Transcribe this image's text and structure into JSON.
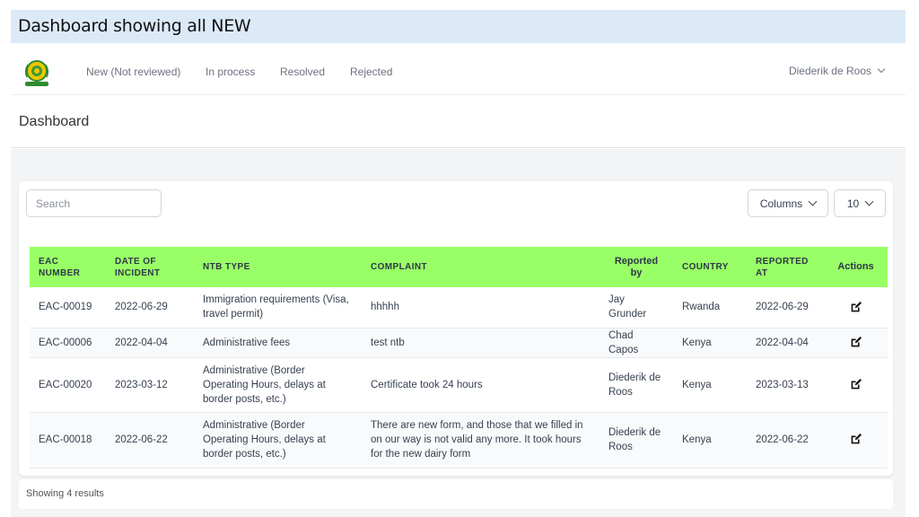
{
  "banner": {
    "title": "Dashboard showing all NEW"
  },
  "nav": {
    "items": [
      "New (Not reviewed)",
      "In process",
      "Resolved",
      "Rejected"
    ],
    "user": "Diederik de Roos"
  },
  "header": {
    "title": "Dashboard"
  },
  "toolbar": {
    "search_placeholder": "Search",
    "columns_label": "Columns",
    "page_size": "10"
  },
  "table": {
    "headers": {
      "eac1": "EAC",
      "eac2": "NUMBER",
      "date1": "DATE OF",
      "date2": "INCIDENT",
      "ntb": "NTB TYPE",
      "complaint": "COMPLAINT",
      "rep1": "Reported",
      "rep2": "by",
      "country": "COUNTRY",
      "at1": "REPORTED",
      "at2": "AT",
      "actions": "Actions"
    },
    "rows": [
      {
        "eac": "EAC-00019",
        "date": "2022-06-29",
        "ntb": "Immigration requirements (Visa, travel permit)",
        "complaint": "hhhhh",
        "by": "Jay Grunder",
        "country": "Rwanda",
        "at": "2022-06-29"
      },
      {
        "eac": "EAC-00006",
        "date": "2022-04-04",
        "ntb": "Administrative fees",
        "complaint": "test ntb",
        "by": "Chad Capos",
        "country": "Kenya",
        "at": "2022-04-04"
      },
      {
        "eac": "EAC-00020",
        "date": "2023-03-12",
        "ntb": "Administrative (Border Operating Hours, delays at border posts, etc.)",
        "complaint": "Certificate took 24 hours",
        "by": "Diederik de Roos",
        "country": "Kenya",
        "at": "2023-03-13"
      },
      {
        "eac": "EAC-00018",
        "date": "2022-06-22",
        "ntb": "Administrative (Border Operating Hours, delays at border posts, etc.)",
        "complaint": "There are new form, and those that we filled in on our way is not valid any more. It took hours for the new dairy form",
        "by": "Diederik de Roos",
        "country": "Kenya",
        "at": "2022-06-22"
      }
    ]
  },
  "footer": {
    "text": "Showing 4 results"
  },
  "colors": {
    "table_header": "#99ff66",
    "banner": "#dce9f7"
  }
}
